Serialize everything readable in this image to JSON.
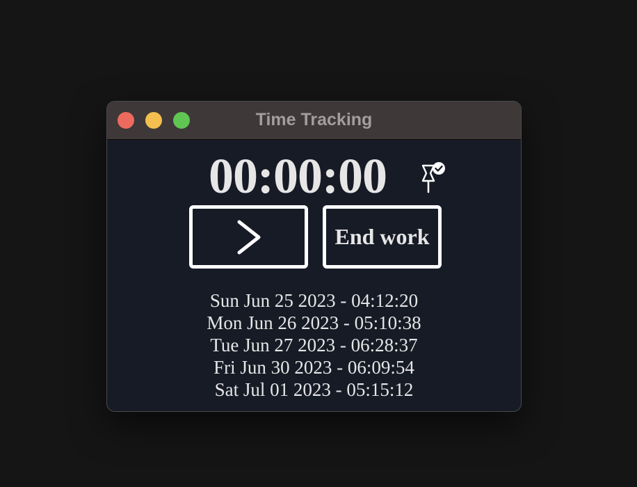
{
  "window": {
    "title": "Time Tracking"
  },
  "timer": {
    "display": "00:00:00",
    "pin_icon": "pin-check-icon"
  },
  "buttons": {
    "start_icon": "chevron-right-icon",
    "end_label": "End work"
  },
  "log": [
    "Sun Jun 25 2023 - 04:12:20",
    "Mon Jun 26 2023 - 05:10:38",
    "Tue Jun 27 2023 - 06:28:37",
    "Fri Jun 30 2023 - 06:09:54",
    "Sat Jul 01 2023 - 05:15:12"
  ],
  "colors": {
    "background": "#151516",
    "window_bg": "#161b26",
    "titlebar_bg": "#3e3838",
    "close": "#ed6a5e",
    "minimize": "#f5bf4f",
    "zoom": "#61c554",
    "text": "#e6e6e6"
  }
}
